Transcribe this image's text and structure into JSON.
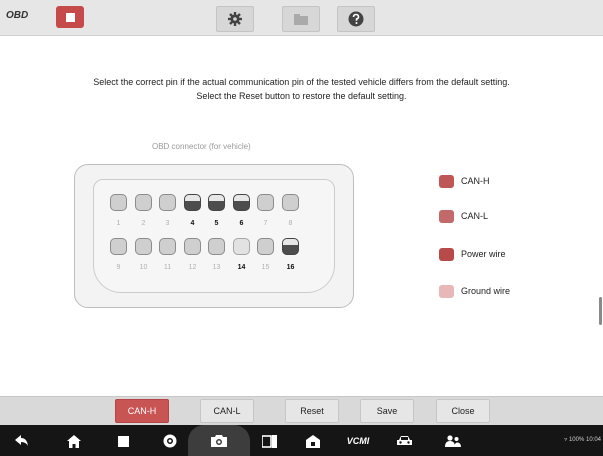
{
  "app": {
    "title": "OBD"
  },
  "toolbar": {
    "icons": [
      "stop-icon",
      "gear-icon",
      "folder-icon",
      "help-icon"
    ]
  },
  "instructions": {
    "line1": "Select the correct pin if the actual communication pin of the tested vehicle differs from the default setting.",
    "line2": "Select the Reset button to restore the default setting."
  },
  "connector": {
    "label": "OBD connector (for vehicle)",
    "top_row": [
      {
        "num": "1",
        "type": "idle"
      },
      {
        "num": "2",
        "type": "idle"
      },
      {
        "num": "3",
        "type": "idle"
      },
      {
        "num": "4",
        "type": "active"
      },
      {
        "num": "5",
        "type": "active"
      },
      {
        "num": "6",
        "type": "active"
      },
      {
        "num": "7",
        "type": "idle"
      },
      {
        "num": "8",
        "type": "idle"
      }
    ],
    "bottom_row": [
      {
        "num": "9",
        "type": "idle"
      },
      {
        "num": "10",
        "type": "idle"
      },
      {
        "num": "11",
        "type": "idle"
      },
      {
        "num": "12",
        "type": "idle"
      },
      {
        "num": "13",
        "type": "idle"
      },
      {
        "num": "14",
        "type": "ground"
      },
      {
        "num": "15",
        "type": "idle"
      },
      {
        "num": "16",
        "type": "active"
      }
    ]
  },
  "legend": [
    {
      "label": "CAN-H",
      "color": "#bf5656"
    },
    {
      "label": "CAN-L",
      "color": "#c26a6a"
    },
    {
      "label": "Power wire",
      "color": "#b84a4a"
    },
    {
      "label": "Ground wire",
      "color": "#e8b7b7"
    }
  ],
  "buttons": {
    "can_h": "CAN-H",
    "can_l": "CAN-L",
    "reset": "Reset",
    "save": "Save",
    "close": "Close"
  },
  "navbar": {
    "icons": [
      "back-icon",
      "home-icon",
      "recent-apps-icon",
      "browser-icon",
      "camera-icon",
      "screen-mirror-icon",
      "shop-icon",
      "vcmi-icon",
      "car-icon",
      "user-group-icon"
    ],
    "vcmi_label": "VCMI",
    "status_text": "100% 10:04"
  },
  "colors": {
    "accent": "#c95454",
    "topbar": "#e6e6e6",
    "navbar": "#151515"
  }
}
